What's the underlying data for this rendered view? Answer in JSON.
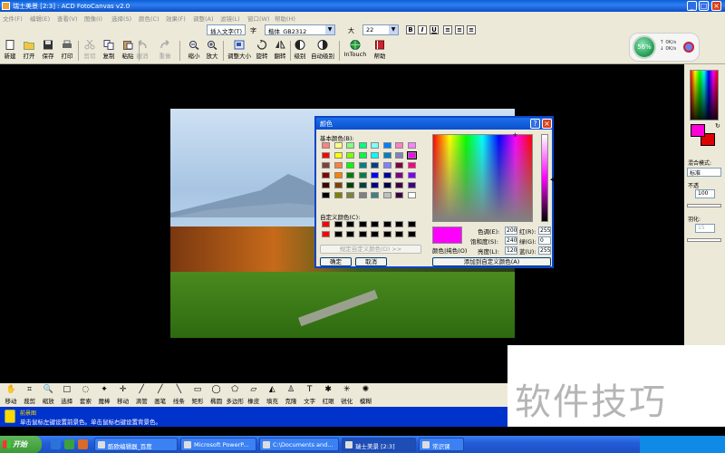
{
  "window": {
    "title": "瑞士美景 [2:3] : ACD FotoCanvas v2.0",
    "controls": [
      "_",
      "□",
      "×"
    ]
  },
  "menu": [
    "文件(F)",
    "编辑(E)",
    "查看(V)",
    "图像(I)",
    "选择(S)",
    "颜色(C)",
    "效果(F)",
    "调整(A)",
    "滤镜(L)",
    "窗口(W)",
    "帮助(H)"
  ],
  "formatbar": {
    "insert_text_label": "插入文字(T)",
    "font_label": "字",
    "font_value": "楷体_GB2312",
    "size_label": "大",
    "size_value": "22",
    "bold": "B",
    "italic": "I",
    "underline": "U"
  },
  "speed_widget": {
    "percent": "56%",
    "up": "0K/s",
    "down": "0K/s"
  },
  "toolbar": {
    "buttons": [
      {
        "label": "新建",
        "enabled": true
      },
      {
        "label": "打开",
        "enabled": true
      },
      {
        "label": "保存",
        "enabled": true
      },
      {
        "label": "打印",
        "enabled": true
      },
      {
        "label": "剪切",
        "enabled": false
      },
      {
        "label": "复制",
        "enabled": true
      },
      {
        "label": "粘贴",
        "enabled": true
      },
      {
        "label": "撤消",
        "enabled": false
      },
      {
        "label": "重做",
        "enabled": false
      },
      {
        "label": "缩小",
        "enabled": true
      },
      {
        "label": "放大",
        "enabled": true
      },
      {
        "label": "调整大小",
        "enabled": true
      },
      {
        "label": "旋转",
        "enabled": true
      },
      {
        "label": "翻转",
        "enabled": true
      },
      {
        "label": "级别",
        "enabled": true
      },
      {
        "label": "自动级别",
        "enabled": true
      },
      {
        "label": "InTouch",
        "enabled": true
      },
      {
        "label": "帮助",
        "enabled": true
      }
    ]
  },
  "right_panel": {
    "blend_mode_label": "混合模式:",
    "blend_mode_value": "标准",
    "opacity_label": "不透",
    "opacity_value": "100",
    "feather_label": "羽化:",
    "feather_value": "15",
    "colors": {
      "foreground": "#ff00d8",
      "background": "#e00000"
    }
  },
  "color_dialog": {
    "title": "颜色",
    "basic_colors_label": "基本颜色(B):",
    "custom_colors_label": "自定义颜色(C):",
    "define_custom_button": "规定自定义颜色(D) >>",
    "ok_button": "确定",
    "cancel_button": "取消",
    "add_custom_button": "添加到自定义颜色(A)",
    "solid_label": "颜色|纯色(O)",
    "hue_label": "色调(E):",
    "hue_value": "200",
    "sat_label": "饱和度(S):",
    "sat_value": "240",
    "lum_label": "亮度(L):",
    "lum_value": "120",
    "red_label": "红(R):",
    "red_value": "255",
    "green_label": "绿(G):",
    "green_value": "0",
    "blue_label": "蓝(U):",
    "blue_value": "255",
    "basic_colors": [
      "#ff8080",
      "#ffff80",
      "#80ff80",
      "#00ff80",
      "#80ffff",
      "#0080ff",
      "#ff80c0",
      "#ff80ff",
      "#ff0000",
      "#ffff00",
      "#80ff00",
      "#00ff40",
      "#00ffff",
      "#0080c0",
      "#8080c0",
      "#ff00ff",
      "#804040",
      "#ff8040",
      "#00ff00",
      "#008080",
      "#004080",
      "#8080ff",
      "#800040",
      "#ff0080",
      "#800000",
      "#ff8000",
      "#008000",
      "#008040",
      "#0000ff",
      "#0000a0",
      "#800080",
      "#8000ff",
      "#400000",
      "#804000",
      "#004000",
      "#004040",
      "#000080",
      "#000040",
      "#400040",
      "#400080",
      "#000000",
      "#808000",
      "#808040",
      "#808080",
      "#408080",
      "#c0c0c0",
      "#400040",
      "#ffffff"
    ],
    "custom_colors": [
      "#ff0000",
      "#000000",
      "#000000",
      "#000000",
      "#000000",
      "#000000",
      "#000000",
      "#000000",
      "#ff0000",
      "#000000",
      "#000000",
      "#000000",
      "#000000",
      "#000000",
      "#000000",
      "#000000"
    ]
  },
  "tools": [
    "移动",
    "裁剪",
    "缩放",
    "选择",
    "套索",
    "魔棒",
    "移动",
    "滴管",
    "画笔",
    "线条",
    "矩形",
    "椭圆",
    "多边形",
    "橡皮",
    "填充",
    "克隆",
    "文字",
    "红眼",
    "锐化",
    "模糊"
  ],
  "status": {
    "title": "前景图",
    "text": "单击鼠标左键设置前景色。单击鼠标右键设置背景色。"
  },
  "watermark": "软件技巧",
  "taskbar": {
    "start_label": "开始",
    "tasks": [
      {
        "label": "酷欧编辑器_百度",
        "active": false
      },
      {
        "label": "Microsoft PowerP...",
        "active": false
      },
      {
        "label": "C:\\Documents and...",
        "active": false
      },
      {
        "label": "瑞士美景 [2:3]",
        "active": true
      },
      {
        "label": "常识课",
        "active": false
      }
    ]
  }
}
